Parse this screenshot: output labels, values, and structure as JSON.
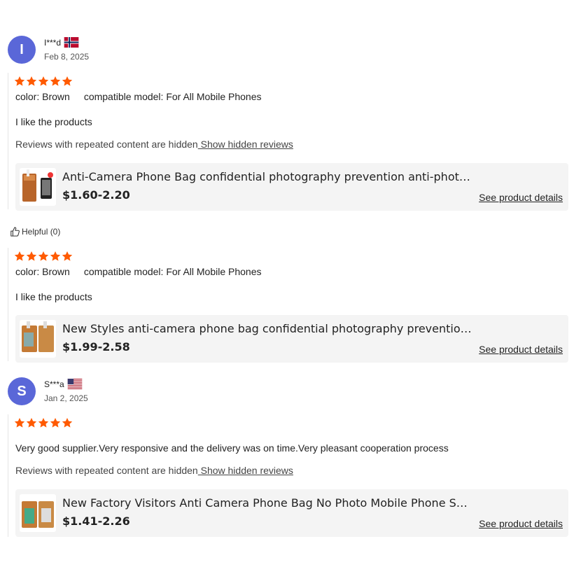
{
  "colors": {
    "star": "#ff5a00",
    "avatar": "#5a67d8",
    "card_bg": "#f4f4f4"
  },
  "reviews": [
    {
      "user": {
        "initial": "I",
        "name": "I***d",
        "date": "Feb 8, 2025",
        "flag": "norway-flag-icon"
      },
      "rating": 5,
      "attrs": {
        "color_label": "color:",
        "color_value": "Brown",
        "model_label": "compatible model:",
        "model_value": "For All Mobile Phones"
      },
      "text": "I like the products",
      "hidden_note": "Reviews with repeated content are hidden",
      "hidden_link": " Show hidden reviews",
      "product": {
        "title": "Anti-Camera Phone Bag confidential photography prevention anti-photo phone bag",
        "price": "$1.60-2.20",
        "link": "See product details"
      }
    },
    {
      "rating": 5,
      "attrs": {
        "color_label": "color:",
        "color_value": "Brown",
        "model_label": "compatible model:",
        "model_value": "For All Mobile Phones"
      },
      "text": "I like the products",
      "product": {
        "title": "New Styles anti-camera phone bag confidential photography prevention cover",
        "price": "$1.99-2.58",
        "link": "See product details"
      }
    },
    {
      "user": {
        "initial": "S",
        "name": "S***a",
        "date": "Jan 2, 2025",
        "flag": "usa-flag-icon"
      },
      "rating": 5,
      "text": "Very good supplier.Very responsive and the delivery was on time.Very pleasant cooperation process",
      "hidden_note": "Reviews with repeated content are hidden",
      "hidden_link": " Show hidden reviews",
      "product": {
        "title": "New Factory Visitors Anti Camera Phone Bag No Photo Mobile Phone Security Pouch",
        "price": "$1.41-2.26",
        "link": "See product details"
      }
    }
  ],
  "helpful": {
    "label": "Helpful (0)"
  }
}
